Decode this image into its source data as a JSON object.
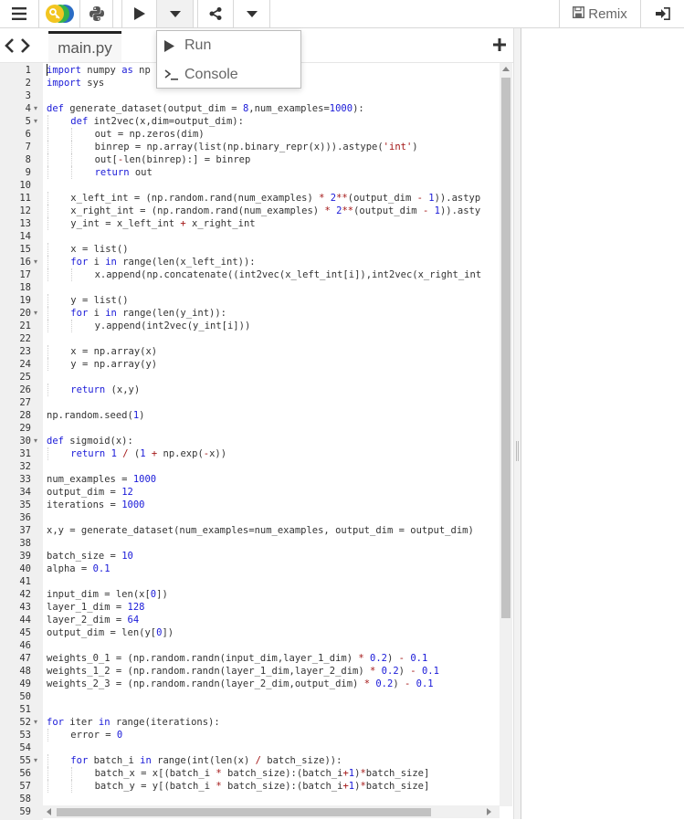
{
  "toolbar": {
    "menu_icon": "hamburger-icon",
    "logo_icon": "trinket-logo-icon",
    "language_icon": "python-icon",
    "run_icon": "play-icon",
    "run_dropdown_icon": "caret-down-icon",
    "share_icon": "share-icon",
    "more_dropdown_icon": "caret-down-icon",
    "remix_label": "Remix",
    "remix_icon": "save-icon",
    "login_icon": "sign-in-icon"
  },
  "run_menu": {
    "items": [
      {
        "label": "Run",
        "icon": "play-icon"
      },
      {
        "label": "Console",
        "icon": "terminal-icon"
      }
    ]
  },
  "tabs": {
    "nav_left_icon": "chevron-left-icon",
    "nav_right_icon": "chevron-right-icon",
    "active_file": "main.py",
    "add_icon": "plus-icon"
  },
  "colors": {
    "keyword": "#1a1ad8",
    "number": "#1a1ad8",
    "string": "#a31515",
    "text": "#333333",
    "gutter": "#f0f0f0"
  },
  "editor": {
    "fold_lines": [
      4,
      5,
      16,
      20,
      30,
      52,
      55
    ],
    "lines": [
      {
        "n": 1,
        "indent": 0,
        "text": "import numpy as np"
      },
      {
        "n": 2,
        "indent": 0,
        "text": "import sys"
      },
      {
        "n": 3,
        "indent": 0,
        "text": ""
      },
      {
        "n": 4,
        "indent": 0,
        "text": "def generate_dataset(output_dim = 8,num_examples=1000):"
      },
      {
        "n": 5,
        "indent": 1,
        "text": "def int2vec(x,dim=output_dim):"
      },
      {
        "n": 6,
        "indent": 2,
        "text": "out = np.zeros(dim)"
      },
      {
        "n": 7,
        "indent": 2,
        "text": "binrep = np.array(list(np.binary_repr(x))).astype('int')"
      },
      {
        "n": 8,
        "indent": 2,
        "text": "out[-len(binrep):] = binrep"
      },
      {
        "n": 9,
        "indent": 2,
        "text": "return out"
      },
      {
        "n": 10,
        "indent": 0,
        "text": ""
      },
      {
        "n": 11,
        "indent": 1,
        "text": "x_left_int = (np.random.rand(num_examples) * 2**(output_dim - 1)).astyp"
      },
      {
        "n": 12,
        "indent": 1,
        "text": "x_right_int = (np.random.rand(num_examples) * 2**(output_dim - 1)).asty"
      },
      {
        "n": 13,
        "indent": 1,
        "text": "y_int = x_left_int + x_right_int"
      },
      {
        "n": 14,
        "indent": 0,
        "text": ""
      },
      {
        "n": 15,
        "indent": 1,
        "text": "x = list()"
      },
      {
        "n": 16,
        "indent": 1,
        "text": "for i in range(len(x_left_int)):"
      },
      {
        "n": 17,
        "indent": 2,
        "text": "x.append(np.concatenate((int2vec(x_left_int[i]),int2vec(x_right_int"
      },
      {
        "n": 18,
        "indent": 0,
        "text": ""
      },
      {
        "n": 19,
        "indent": 1,
        "text": "y = list()"
      },
      {
        "n": 20,
        "indent": 1,
        "text": "for i in range(len(y_int)):"
      },
      {
        "n": 21,
        "indent": 2,
        "text": "y.append(int2vec(y_int[i]))"
      },
      {
        "n": 22,
        "indent": 0,
        "text": ""
      },
      {
        "n": 23,
        "indent": 1,
        "text": "x = np.array(x)"
      },
      {
        "n": 24,
        "indent": 1,
        "text": "y = np.array(y)"
      },
      {
        "n": 25,
        "indent": 0,
        "text": ""
      },
      {
        "n": 26,
        "indent": 1,
        "text": "return (x,y)"
      },
      {
        "n": 27,
        "indent": 0,
        "text": ""
      },
      {
        "n": 28,
        "indent": 0,
        "text": "np.random.seed(1)"
      },
      {
        "n": 29,
        "indent": 0,
        "text": ""
      },
      {
        "n": 30,
        "indent": 0,
        "text": "def sigmoid(x):"
      },
      {
        "n": 31,
        "indent": 1,
        "text": "return 1 / (1 + np.exp(-x))"
      },
      {
        "n": 32,
        "indent": 0,
        "text": ""
      },
      {
        "n": 33,
        "indent": 0,
        "text": "num_examples = 1000"
      },
      {
        "n": 34,
        "indent": 0,
        "text": "output_dim = 12"
      },
      {
        "n": 35,
        "indent": 0,
        "text": "iterations = 1000"
      },
      {
        "n": 36,
        "indent": 0,
        "text": ""
      },
      {
        "n": 37,
        "indent": 0,
        "text": "x,y = generate_dataset(num_examples=num_examples, output_dim = output_dim)"
      },
      {
        "n": 38,
        "indent": 0,
        "text": ""
      },
      {
        "n": 39,
        "indent": 0,
        "text": "batch_size = 10"
      },
      {
        "n": 40,
        "indent": 0,
        "text": "alpha = 0.1"
      },
      {
        "n": 41,
        "indent": 0,
        "text": ""
      },
      {
        "n": 42,
        "indent": 0,
        "text": "input_dim = len(x[0])"
      },
      {
        "n": 43,
        "indent": 0,
        "text": "layer_1_dim = 128"
      },
      {
        "n": 44,
        "indent": 0,
        "text": "layer_2_dim = 64"
      },
      {
        "n": 45,
        "indent": 0,
        "text": "output_dim = len(y[0])"
      },
      {
        "n": 46,
        "indent": 0,
        "text": ""
      },
      {
        "n": 47,
        "indent": 0,
        "text": "weights_0_1 = (np.random.randn(input_dim,layer_1_dim) * 0.2) - 0.1"
      },
      {
        "n": 48,
        "indent": 0,
        "text": "weights_1_2 = (np.random.randn(layer_1_dim,layer_2_dim) * 0.2) - 0.1"
      },
      {
        "n": 49,
        "indent": 0,
        "text": "weights_2_3 = (np.random.randn(layer_2_dim,output_dim) * 0.2) - 0.1"
      },
      {
        "n": 50,
        "indent": 0,
        "text": ""
      },
      {
        "n": 51,
        "indent": 0,
        "text": ""
      },
      {
        "n": 52,
        "indent": 0,
        "text": "for iter in range(iterations):"
      },
      {
        "n": 53,
        "indent": 1,
        "text": "error = 0"
      },
      {
        "n": 54,
        "indent": 0,
        "text": ""
      },
      {
        "n": 55,
        "indent": 1,
        "text": "for batch_i in range(int(len(x) / batch_size)):"
      },
      {
        "n": 56,
        "indent": 2,
        "text": "batch_x = x[(batch_i * batch_size):(batch_i+1)*batch_size]"
      },
      {
        "n": 57,
        "indent": 2,
        "text": "batch_y = y[(batch_i * batch_size):(batch_i+1)*batch_size]"
      },
      {
        "n": 58,
        "indent": 0,
        "text": ""
      },
      {
        "n": 59,
        "indent": 0,
        "text": ""
      }
    ]
  }
}
